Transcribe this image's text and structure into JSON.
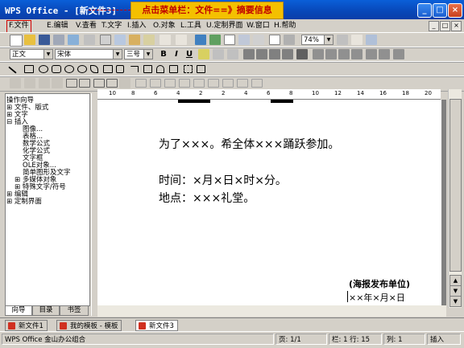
{
  "window": {
    "title": "WPS Office - [新文件3]",
    "minimize": "_",
    "maximize": "□",
    "close": "×"
  },
  "callout": "点击菜单栏：文件==》摘要信息",
  "menu": [
    {
      "label": "F.文件",
      "highlighted": true
    },
    {
      "label": "E.编辑"
    },
    {
      "label": "V.查看"
    },
    {
      "label": "T.文字"
    },
    {
      "label": "I.插入"
    },
    {
      "label": "O.对象"
    },
    {
      "label": "L.工具"
    },
    {
      "label": "U.定制界面"
    },
    {
      "label": "W.窗口"
    },
    {
      "label": "H.帮助"
    }
  ],
  "mdi_buttons": [
    "_",
    "□",
    "×"
  ],
  "toolbar": {
    "zoom": "74%",
    "style": "正文",
    "font": "宋体",
    "size": "三号",
    "bold": "B",
    "italic": "I",
    "underline": "U"
  },
  "left_panel": {
    "title": "操作向导",
    "tree": [
      {
        "label": "⊞ 文件、版式",
        "indent": 0
      },
      {
        "label": "⊞ 文字",
        "indent": 0
      },
      {
        "label": "⊟ 插入",
        "indent": 0
      },
      {
        "label": "图像...",
        "indent": 2
      },
      {
        "label": "表格...",
        "indent": 2
      },
      {
        "label": "数学公式",
        "indent": 2
      },
      {
        "label": "化学公式",
        "indent": 2
      },
      {
        "label": "文字框",
        "indent": 2
      },
      {
        "label": "OLE对象...",
        "indent": 2
      },
      {
        "label": "简单图形及文字",
        "indent": 2
      },
      {
        "label": "⊞ 多媒体对象",
        "indent": 1
      },
      {
        "label": "⊞ 特殊文字/符号",
        "indent": 1
      },
      {
        "label": "⊞ 编辑",
        "indent": 0
      },
      {
        "label": "⊞ 定制界面",
        "indent": 0
      }
    ],
    "tabs": [
      "向导",
      "目录",
      "书签"
    ]
  },
  "ruler": [
    "10",
    "8",
    "6",
    "4",
    "2",
    "2",
    "4",
    "6",
    "8",
    "10",
    "12",
    "14",
    "16",
    "18",
    "20"
  ],
  "document": {
    "lines": [
      "为了×××。希全体×××踊跃参加。",
      "时间：×月×日×时×分。",
      "地点：×××礼堂。"
    ],
    "publisher": "(海报发布单位)",
    "date": "××年×月×日"
  },
  "doc_tabs": [
    {
      "label": "新文件1",
      "active": false
    },
    {
      "label": "我的模板 - 模板",
      "active": false
    },
    {
      "label": "新文件3",
      "active": true
    }
  ],
  "status": {
    "app": "WPS Office 金山办公组合",
    "page": "页: 1/1",
    "column_row": "栏: 1 行: 15",
    "col": "列: 1",
    "mode": "插入"
  },
  "colors": {
    "titlebar": "#0a4fc8",
    "callout_bg": "#f4c000",
    "callout_text": "#c00000",
    "chrome": "#d4d0c8"
  }
}
